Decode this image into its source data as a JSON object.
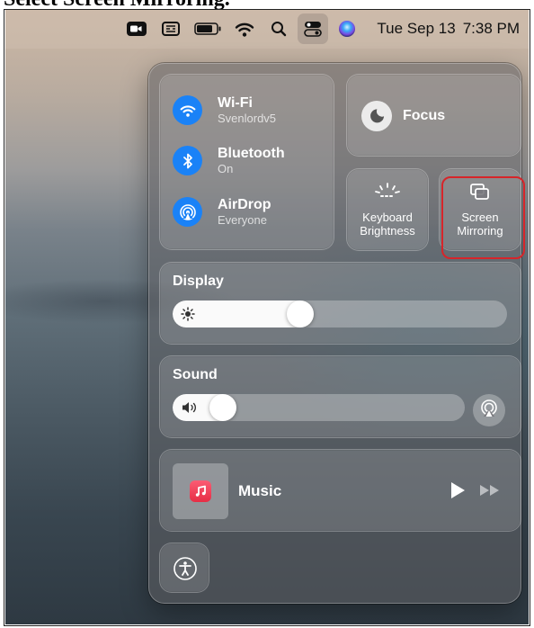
{
  "heading": {
    "text": "Select Screen Mirroring."
  },
  "menubar": {
    "icons": [
      "zoom-camera-icon",
      "input-source-icon",
      "battery-icon",
      "wifi-icon",
      "search-icon",
      "control-center-icon",
      "siri-icon"
    ],
    "date": "Tue Sep 13",
    "time": "7:38 PM"
  },
  "control_center": {
    "network": {
      "wifi": {
        "title": "Wi-Fi",
        "subtitle": "Svenlordv5",
        "icon": "wifi-icon",
        "color": "#1a82f7"
      },
      "bluetooth": {
        "title": "Bluetooth",
        "subtitle": "On",
        "icon": "bluetooth-icon",
        "color": "#1a82f7"
      },
      "airdrop": {
        "title": "AirDrop",
        "subtitle": "Everyone",
        "icon": "airdrop-icon",
        "color": "#1a82f7"
      }
    },
    "focus": {
      "label": "Focus",
      "icon": "moon-icon"
    },
    "keyboard_brightness": {
      "line1": "Keyboard",
      "line2": "Brightness",
      "icon": "keyboard-brightness-icon"
    },
    "screen_mirroring": {
      "line1": "Screen",
      "line2": "Mirroring",
      "icon": "screen-mirroring-icon",
      "highlight_color": "#d6252a"
    },
    "display": {
      "title": "Display",
      "level": 0.37,
      "icon": "sun-icon"
    },
    "sound": {
      "title": "Sound",
      "level": 0.14,
      "icon": "speaker-icon",
      "output_icon": "airplay-audio-icon"
    },
    "now_playing": {
      "app": "Music",
      "icon": "music-app-icon",
      "controls": [
        "play-icon",
        "fast-forward-icon"
      ]
    },
    "accessibility": {
      "icon": "accessibility-icon"
    }
  }
}
